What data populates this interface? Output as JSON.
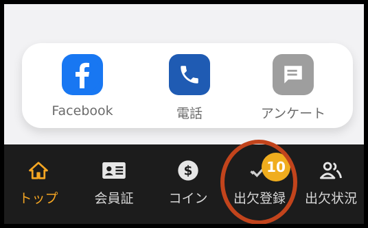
{
  "quick_links": [
    {
      "label": "Facebook",
      "icon": "facebook-icon",
      "color": "#1877f2"
    },
    {
      "label": "電話",
      "icon": "phone-icon",
      "color": "#1f5bb3"
    },
    {
      "label": "アンケート",
      "icon": "survey-icon",
      "color": "#9e9e9e"
    }
  ],
  "tabs": [
    {
      "label": "トップ",
      "icon": "home-icon",
      "active": true
    },
    {
      "label": "会員証",
      "icon": "member-card-icon",
      "active": false
    },
    {
      "label": "コイン",
      "icon": "coin-icon",
      "active": false
    },
    {
      "label": "出欠登録",
      "icon": "attendance-check-icon",
      "active": false,
      "badge": "10"
    },
    {
      "label": "出欠状況",
      "icon": "attendance-status-icon",
      "active": false
    }
  ],
  "colors": {
    "active_tab": "#f5a623",
    "badge": "#f0ad1e",
    "highlight_ring": "#c2441c"
  }
}
